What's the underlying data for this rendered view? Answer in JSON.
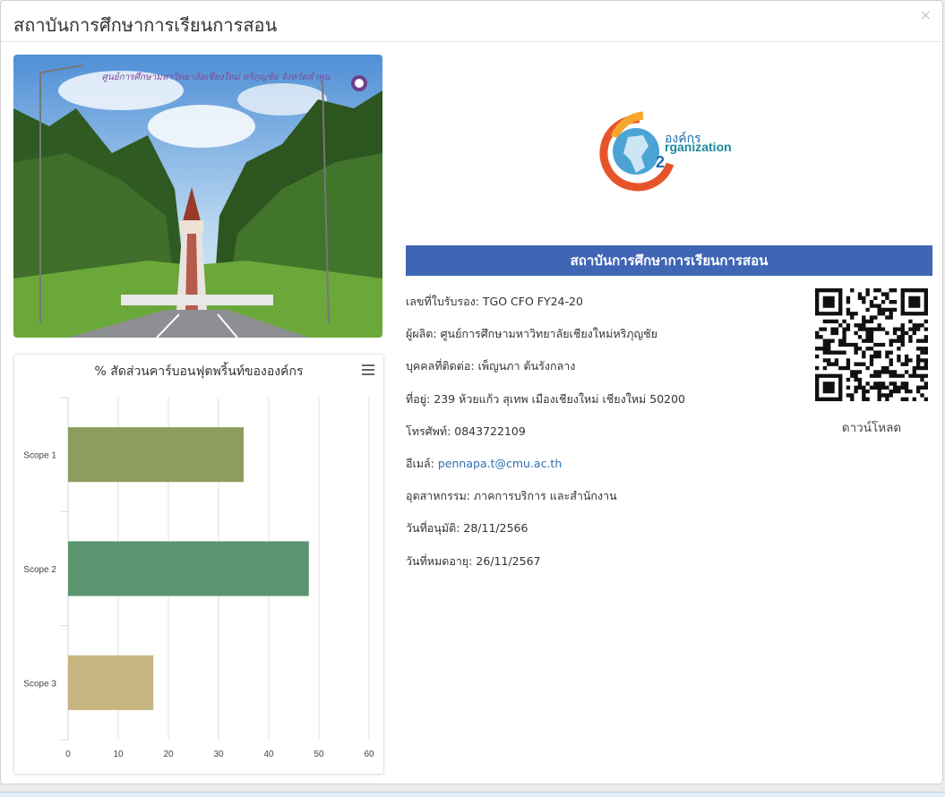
{
  "modal": {
    "title": "สถาบันการศึกษาการเรียนการสอน",
    "close_label": "×"
  },
  "photo": {
    "caption": "ศูนย์การศึกษามหาวิทยาลัยเชียงใหม่ หริภุญชัย จังหวัดลำพูน"
  },
  "chart": {
    "menu_icon": "hamburger-icon"
  },
  "chart_data": {
    "type": "bar",
    "orientation": "horizontal",
    "title": "% สัดส่วนคาร์บอนฟุตพริ้นท์ขององค์กร",
    "categories": [
      "Scope 1",
      "Scope 2",
      "Scope 3"
    ],
    "values": [
      35,
      48,
      17
    ],
    "colors": [
      "#8d9d5c",
      "#5b9570",
      "#c6b57f"
    ],
    "xlim": [
      0,
      60
    ],
    "xticks": [
      "0",
      "10",
      "20",
      "30",
      "40",
      "50",
      "60"
    ],
    "grid": true,
    "legend": "none"
  },
  "logo": {
    "line1": "องค์กร",
    "line2": "rganization",
    "superscript": "2"
  },
  "banner": {
    "title": "สถาบันการศึกษาการเรียนการสอน"
  },
  "info": {
    "cert_no": "เลขที่ใบรับรอง: TGO CFO FY24-20",
    "producer": "ผู้ผลิต: ศูนย์การศึกษามหาวิทยาลัยเชียงใหม่หริภุญชัย",
    "contact": "บุคคลที่ติดต่อ: เพ็ญนภา ต้นรังกลาง",
    "address": "ที่อยู่: 239 ห้วยแก้ว สุเทพ เมืองเชียงใหม่ เชียงใหม่ 50200",
    "phone": "โทรศัพท์: 0843722109",
    "email_label": "อีเมล์: ",
    "email": "pennapa.t@cmu.ac.th",
    "industry": "อุตสาหกรรม: ภาคการบริการ และสำนักงาน",
    "approved": "วันที่อนุมัติ: 28/11/2566",
    "expiry": "วันที่หมดอายุ: 26/11/2567"
  },
  "qr": {
    "download_label": "ดาวน์โหลด"
  }
}
